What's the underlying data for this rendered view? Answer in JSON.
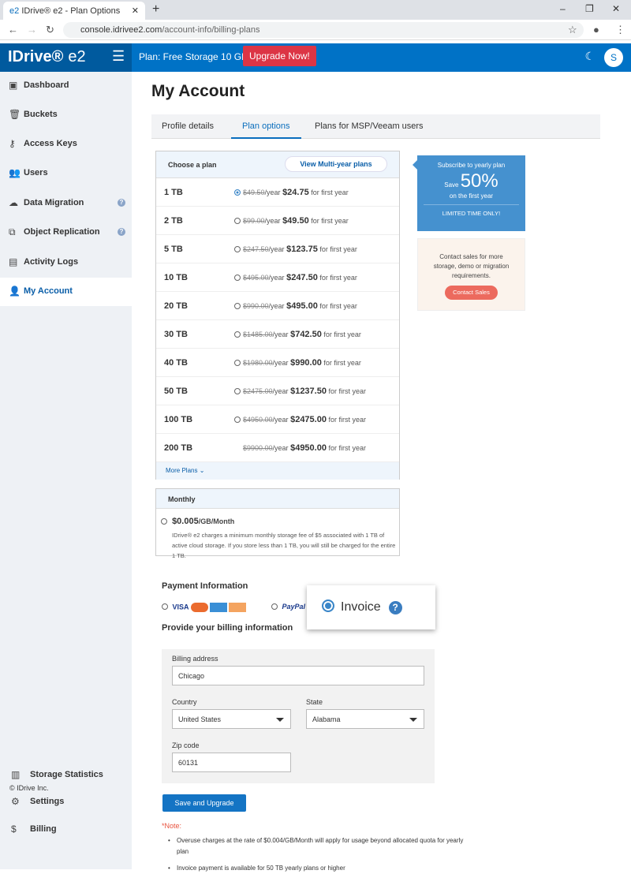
{
  "browser": {
    "tab_title": "IDrive® e2 - Plan Options",
    "url_host": "console.idrivee2.com",
    "url_path": "/account-info/billing-plans"
  },
  "header": {
    "logo": "IDrive®",
    "logo_suffix": "e2",
    "plan": "Plan: Free Storage 10 GB",
    "upgrade": "Upgrade Now!",
    "avatar": "S"
  },
  "sidebar": {
    "items": [
      {
        "label": "Dashboard",
        "icon": "▣"
      },
      {
        "label": "Buckets",
        "icon": "🗑"
      },
      {
        "label": "Access Keys",
        "icon": "⚷"
      },
      {
        "label": "Users",
        "icon": "👥"
      },
      {
        "label": "Data Migration",
        "icon": "☁"
      },
      {
        "label": "Object Replication",
        "icon": "⧉"
      },
      {
        "label": "Activity Logs",
        "icon": "▤"
      },
      {
        "label": "My Account",
        "icon": "👤"
      }
    ],
    "bottom": [
      {
        "label": "Storage Statistics",
        "icon": "▥"
      },
      {
        "label": "Settings",
        "icon": "⚙"
      },
      {
        "label": "Billing",
        "icon": "$"
      }
    ],
    "copyright": "© IDrive Inc."
  },
  "page": {
    "title": "My Account",
    "tabs": [
      "Profile details",
      "Plan options",
      "Plans for MSP/Veeam users"
    ]
  },
  "plans": {
    "header": "Choose a plan",
    "multi_year": "View Multi-year plans",
    "more": "More Plans",
    "rows": [
      {
        "size": "1 TB",
        "orig": "$49.50",
        "price": "$24.75",
        "selected": true
      },
      {
        "size": "2 TB",
        "orig": "$99.00",
        "price": "$49.50"
      },
      {
        "size": "5 TB",
        "orig": "$247.50",
        "price": "$123.75"
      },
      {
        "size": "10 TB",
        "orig": "$495.00",
        "price": "$247.50"
      },
      {
        "size": "20 TB",
        "orig": "$990.00",
        "price": "$495.00"
      },
      {
        "size": "30 TB",
        "orig": "$1485.00",
        "price": "$742.50"
      },
      {
        "size": "40 TB",
        "orig": "$1980.00",
        "price": "$990.00"
      },
      {
        "size": "50 TB",
        "orig": "$2475.00",
        "price": "$1237.50"
      },
      {
        "size": "100 TB",
        "orig": "$4950.00",
        "price": "$2475.00"
      },
      {
        "size": "200 TB",
        "orig": "$9900.00",
        "price": "$4950.00",
        "no_radio": true
      }
    ],
    "per_year": "/year",
    "first_year": "for first year"
  },
  "monthly": {
    "header": "Monthly",
    "price": "$0.005",
    "unit": "/GB/Month",
    "note": "IDrive® e2 charges a minimum monthly storage fee of $5 associated with 1 TB of active cloud storage. If you store less than 1 TB, you will still be charged for the entire 1 TB."
  },
  "promo": {
    "line1": "Subscribe to yearly plan",
    "save": "Save",
    "pct": "50%",
    "line3": "on the first year",
    "limited": "LIMITED TIME ONLY!"
  },
  "contact": {
    "text": "Contact sales for more storage, demo or migration requirements.",
    "button": "Contact Sales"
  },
  "payment": {
    "title": "Payment Information",
    "visa": "VISA",
    "paypal": "PayPal",
    "invoice": "Invoice",
    "billing_title": "Provide your billing information"
  },
  "form": {
    "address_label": "Billing address",
    "address": "Chicago",
    "country_label": "Country",
    "country": "United States",
    "state_label": "State",
    "state": "Alabama",
    "zip_label": "Zip code",
    "zip": "60131"
  },
  "save": "Save and Upgrade",
  "note": {
    "title": "*Note:",
    "items": [
      "Overuse charges at the rate of $0.004/GB/Month will apply for usage beyond allocated quota for yearly plan",
      "Invoice payment is available for 50 TB yearly plans or higher"
    ]
  }
}
